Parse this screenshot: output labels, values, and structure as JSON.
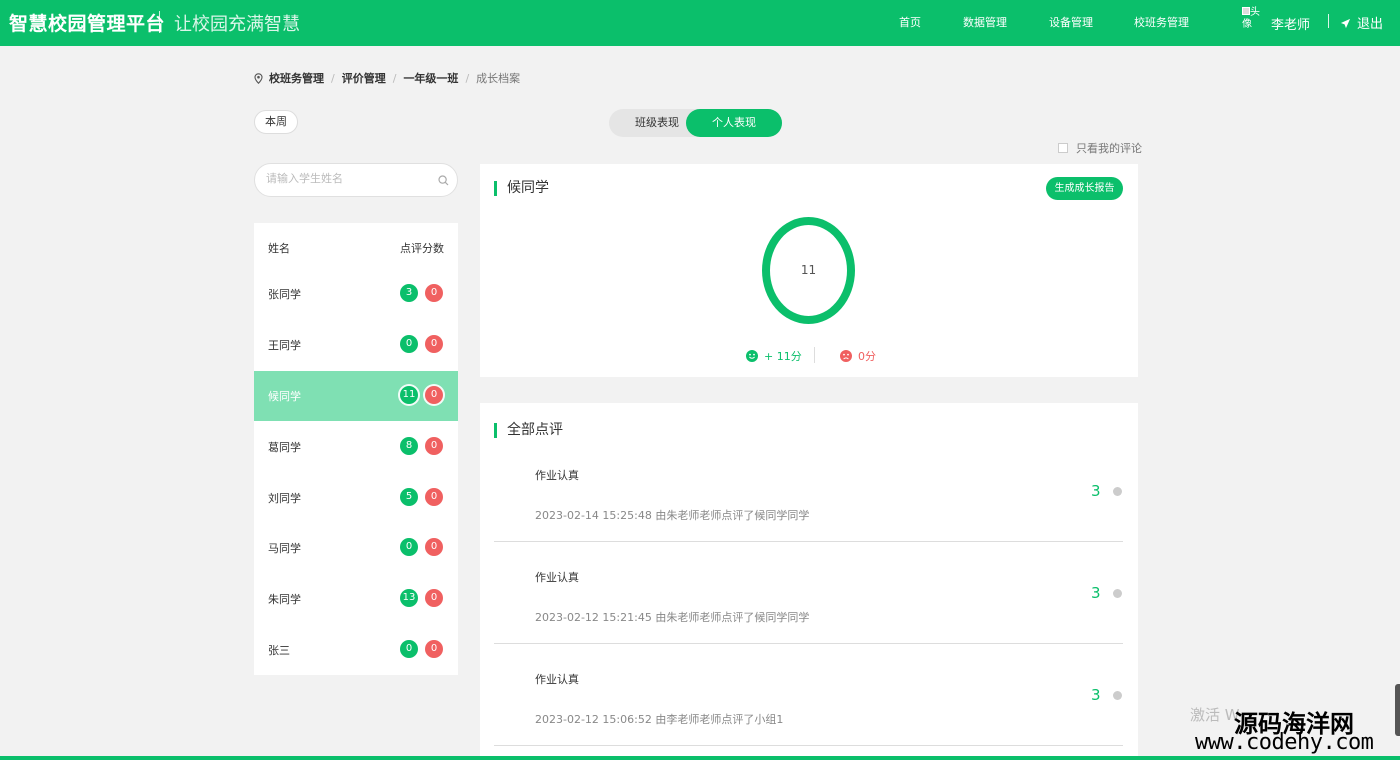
{
  "header": {
    "logo": "智慧校园管理平台",
    "slogan": "让校园充满智慧",
    "nav": [
      "首页",
      "数据管理",
      "设备管理",
      "校班务管理"
    ],
    "avatar_alt": "头像",
    "user": "李老师",
    "logout": "退出"
  },
  "breadcrumb": {
    "items": [
      "校班务管理",
      "评价管理",
      "一年级一班"
    ],
    "current": "成长档案"
  },
  "week_label": "本周",
  "toggle": {
    "class_label": "班级表现",
    "personal_label": "个人表现"
  },
  "only_mine_label": "只看我的评论",
  "search": {
    "placeholder": "请输入学生姓名"
  },
  "list": {
    "head_name": "姓名",
    "head_score": "点评分数",
    "students": [
      {
        "name": "张同学",
        "pos": "3",
        "neg": "0"
      },
      {
        "name": "王同学",
        "pos": "0",
        "neg": "0"
      },
      {
        "name": "候同学",
        "pos": "11",
        "neg": "0"
      },
      {
        "name": "葛同学",
        "pos": "8",
        "neg": "0"
      },
      {
        "name": "刘同学",
        "pos": "5",
        "neg": "0"
      },
      {
        "name": "马同学",
        "pos": "0",
        "neg": "0"
      },
      {
        "name": "朱同学",
        "pos": "13",
        "neg": "0"
      },
      {
        "name": "张三",
        "pos": "0",
        "neg": "0"
      }
    ],
    "active_index": 2
  },
  "profile": {
    "name": "候同学",
    "report_btn": "生成成长报告",
    "total": "11",
    "pos_label": "+ 11分",
    "neg_label": "0分"
  },
  "comments": {
    "title": "全部点评",
    "items": [
      {
        "title": "作业认真",
        "meta": "2023-02-14 15:25:48 由朱老师老师点评了候同学同学",
        "score": "3"
      },
      {
        "title": "作业认真",
        "meta": "2023-02-12 15:21:45 由朱老师老师点评了候同学同学",
        "score": "3"
      },
      {
        "title": "作业认真",
        "meta": "2023-02-12 15:06:52 由李老师老师点评了小组1",
        "score": "3"
      }
    ]
  },
  "watermark": {
    "cn": "源码海洋网",
    "url": "www.codehy.com",
    "activate": "激活 W"
  },
  "colors": {
    "accent": "#0bbf6b",
    "negative": "#f06060",
    "active_row": "#7fe0b3"
  }
}
